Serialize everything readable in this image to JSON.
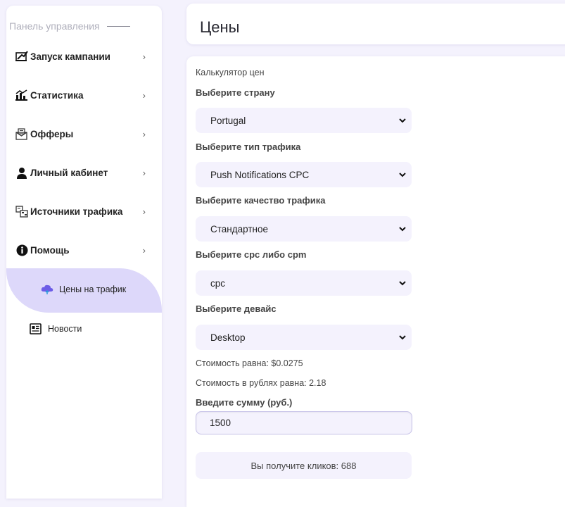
{
  "sidebar": {
    "header": "Панель управления",
    "items": [
      {
        "label": "Запуск кампании",
        "icon": "launch-icon"
      },
      {
        "label": "Статистика",
        "icon": "chart-icon"
      },
      {
        "label": "Офферы",
        "icon": "offers-icon"
      },
      {
        "label": "Личный кабинет",
        "icon": "user-icon"
      },
      {
        "label": "Источники трафика",
        "icon": "traffic-sources-icon"
      },
      {
        "label": "Помощь",
        "icon": "info-icon"
      }
    ],
    "subitems": [
      {
        "label": "Цены на трафик",
        "icon": "cloud-icon",
        "active": true
      },
      {
        "label": "Новости",
        "icon": "newspaper-icon",
        "active": false
      }
    ]
  },
  "header": {
    "title": "Цены"
  },
  "calculator": {
    "title": "Калькулятор цен",
    "country_label": "Выберите страну",
    "country_value": "Portugal",
    "traffic_type_label": "Выберите тип трафика",
    "traffic_type_value": "Push Notifications CPC",
    "quality_label": "Выберите качество трафика",
    "quality_value": "Стандартное",
    "model_label": "Выберите cpc либо cpm",
    "model_value": "cpc",
    "device_label": "Выберите девайс",
    "device_value": "Desktop",
    "cost_usd": "Стоимость равна: $0.0275",
    "cost_rub": "Стоимость в рублях равна: 2.18",
    "amount_label": "Введите сумму (руб.)",
    "amount_value": "1500",
    "result": "Вы получите кликов: 688"
  },
  "colors": {
    "background": "#f4f2fd",
    "active_pill": "#ddd8fa",
    "field_bg": "#f4f2fd",
    "cloud_icon": "#6c5ce7"
  }
}
